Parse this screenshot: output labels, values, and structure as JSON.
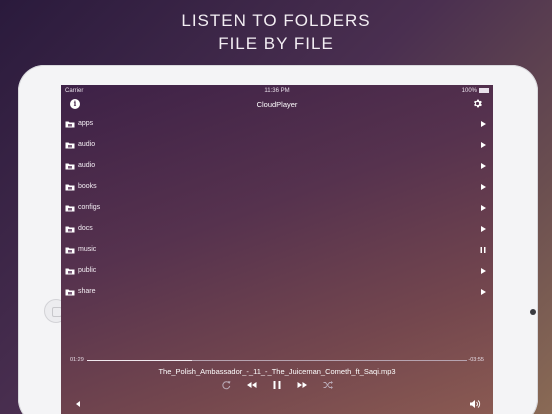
{
  "headline": {
    "line1": "LISTEN TO FOLDERS",
    "line2": "FILE BY FILE"
  },
  "statusbar": {
    "carrier": "Carrier",
    "time": "11:36 PM",
    "battery": "100%"
  },
  "navbar": {
    "title": "CloudPlayer",
    "info_icon": "info-icon",
    "settings_icon": "gear-icon"
  },
  "folders": [
    {
      "label": "apps",
      "action": "play"
    },
    {
      "label": "audio",
      "action": "play"
    },
    {
      "label": "audio",
      "action": "play"
    },
    {
      "label": "books",
      "action": "play"
    },
    {
      "label": "configs",
      "action": "play"
    },
    {
      "label": "docs",
      "action": "play"
    },
    {
      "label": "music",
      "action": "pause"
    },
    {
      "label": "public",
      "action": "play"
    },
    {
      "label": "share",
      "action": "play"
    }
  ],
  "player": {
    "elapsed": "01:29",
    "remaining": "-03:55",
    "progress_fraction": 0.275,
    "now_playing": "The_Polish_Ambassador_-_11_-_The_Juiceman_Cometh_ft_Saqi.mp3"
  },
  "colors": {
    "accent_white": "#ffffff",
    "frame": "#f4f4f6"
  }
}
